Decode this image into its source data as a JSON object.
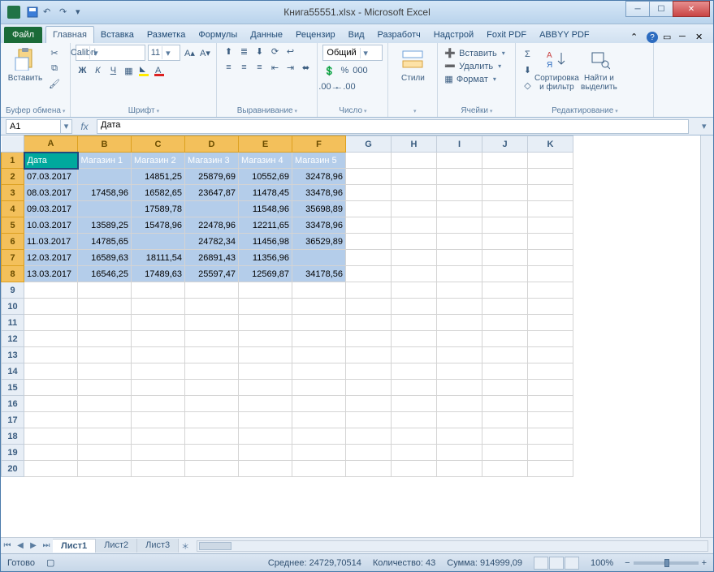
{
  "window": {
    "title": "Книга55551.xlsx - Microsoft Excel"
  },
  "ribbon_tabs": {
    "file": "Файл",
    "items": [
      "Главная",
      "Вставка",
      "Разметка",
      "Формулы",
      "Данные",
      "Рецензир",
      "Вид",
      "Разработч",
      "Надстрой",
      "Foxit PDF",
      "ABBYY PDF"
    ],
    "active_index": 0
  },
  "ribbon_groups": {
    "clipboard": {
      "paste": "Вставить",
      "label": "Буфер обмена"
    },
    "font": {
      "name": "Calibri",
      "size": "11",
      "label": "Шрифт"
    },
    "alignment": {
      "label": "Выравнивание"
    },
    "number": {
      "format": "Общий",
      "label": "Число"
    },
    "styles": {
      "btn": "Стили",
      "label": ""
    },
    "cells": {
      "insert": "Вставить",
      "delete": "Удалить",
      "format": "Формат",
      "label": "Ячейки"
    },
    "editing": {
      "sort": "Сортировка\nи фильтр",
      "find": "Найти и\nвыделить",
      "label": "Редактирование"
    }
  },
  "name_box": "A1",
  "formula_value": "Дата",
  "columns": [
    "A",
    "B",
    "C",
    "D",
    "E",
    "F",
    "G",
    "H",
    "I",
    "J",
    "K"
  ],
  "selected_cols": [
    "A",
    "B",
    "C",
    "D",
    "E",
    "F"
  ],
  "headers": [
    "Дата",
    "Магазин 1",
    "Магазин 2",
    "Магазин 3",
    "Магазин 4",
    "Магазин 5"
  ],
  "rows": [
    {
      "n": 2,
      "date": "07.03.2017",
      "v": [
        "",
        "14851,25",
        "25879,69",
        "10552,69",
        "32478,96"
      ]
    },
    {
      "n": 3,
      "date": "08.03.2017",
      "v": [
        "17458,96",
        "16582,65",
        "23647,87",
        "11478,45",
        "33478,96"
      ]
    },
    {
      "n": 4,
      "date": "09.03.2017",
      "v": [
        "",
        "17589,78",
        "",
        "11548,96",
        "35698,89"
      ]
    },
    {
      "n": 5,
      "date": "10.03.2017",
      "v": [
        "13589,25",
        "15478,96",
        "22478,96",
        "12211,65",
        "33478,96"
      ]
    },
    {
      "n": 6,
      "date": "11.03.2017",
      "v": [
        "14785,65",
        "",
        "24782,34",
        "11456,98",
        "36529,89"
      ]
    },
    {
      "n": 7,
      "date": "12.03.2017",
      "v": [
        "16589,63",
        "18111,54",
        "26891,43",
        "11356,96",
        ""
      ]
    },
    {
      "n": 8,
      "date": "13.03.2017",
      "v": [
        "16546,25",
        "17489,63",
        "25597,47",
        "12569,87",
        "34178,56"
      ]
    }
  ],
  "empty_rows": [
    9,
    10,
    11,
    12,
    13,
    14,
    15,
    16,
    17,
    18,
    19,
    20
  ],
  "sheet_tabs": [
    "Лист1",
    "Лист2",
    "Лист3"
  ],
  "active_sheet": 0,
  "status": {
    "ready": "Готово",
    "avg_lbl": "Среднее:",
    "avg": "24729,70514",
    "cnt_lbl": "Количество:",
    "cnt": "43",
    "sum_lbl": "Сумма:",
    "sum": "914999,09",
    "zoom": "100%"
  }
}
